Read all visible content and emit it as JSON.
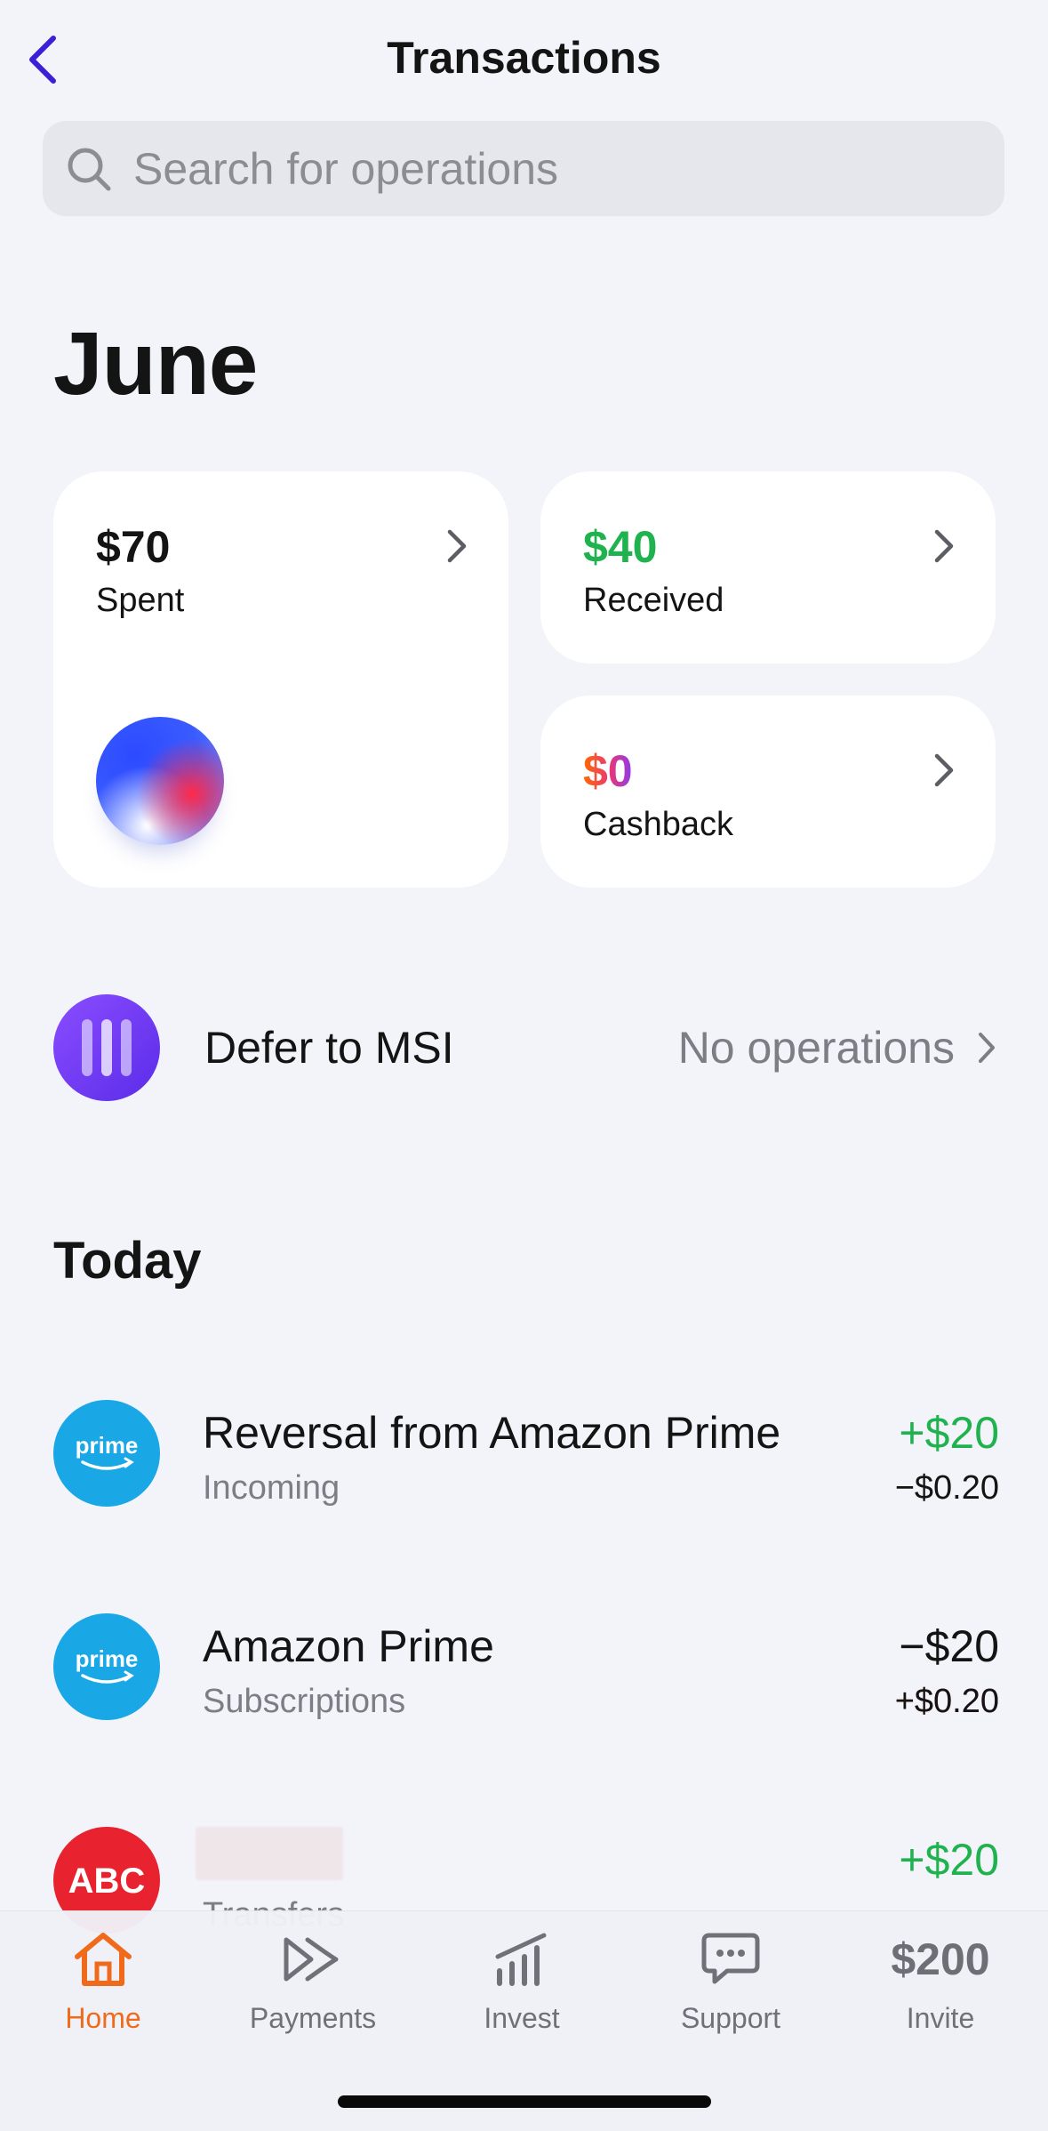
{
  "header": {
    "title": "Transactions",
    "back_icon": "chevron-left-icon"
  },
  "search": {
    "placeholder": "Search for operations",
    "value": ""
  },
  "month": "June",
  "summary": {
    "spent": {
      "amount": "$70",
      "label": "Spent"
    },
    "received": {
      "amount": "$40",
      "label": "Received"
    },
    "cashback": {
      "amount": "$0",
      "label": "Cashback"
    }
  },
  "msi": {
    "label": "Defer to MSI",
    "status": "No operations"
  },
  "section_today": "Today",
  "transactions": [
    {
      "logo": "prime",
      "name": "Reversal from Amazon Prime",
      "category": "Incoming",
      "amount": "+$20",
      "sub_amount": "−$0.20"
    },
    {
      "logo": "prime",
      "name": "Amazon Prime",
      "category": "Subscriptions",
      "amount": "−$20",
      "sub_amount": "+$0.20"
    },
    {
      "logo": "ABC",
      "name": "",
      "category": "Transfers",
      "amount": "+$20",
      "sub_amount": ""
    }
  ],
  "tabs": [
    {
      "label": "Home",
      "icon": "home-icon",
      "active": true
    },
    {
      "label": "Payments",
      "icon": "fast-forward-icon",
      "active": false
    },
    {
      "label": "Invest",
      "icon": "bar-chart-icon",
      "active": false
    },
    {
      "label": "Support",
      "icon": "chat-bubble-icon",
      "active": false
    },
    {
      "label": "Invite",
      "amount": "$200",
      "active": false
    }
  ],
  "colors": {
    "accent_back": "#3d1fd6",
    "positive": "#1fb24f",
    "active_tab": "#f06a1c",
    "prime_blue": "#1aa7e6",
    "abc_red": "#e8232f",
    "msi_purple": "#6a36f0"
  }
}
